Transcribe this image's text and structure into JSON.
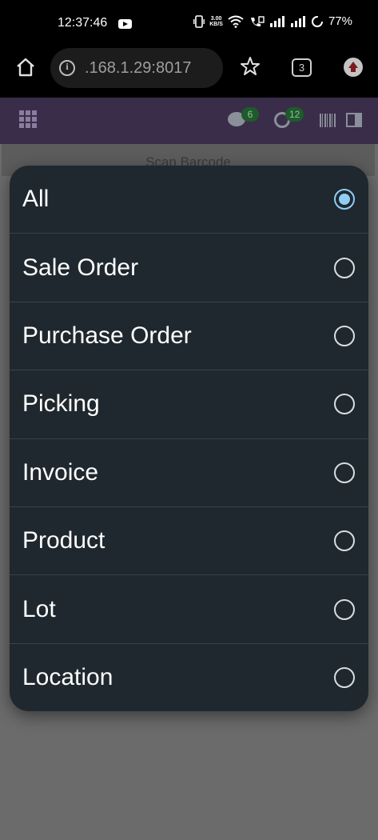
{
  "status_bar": {
    "time": "12:37:46",
    "net_speed_value": "3.00",
    "net_speed_unit": "KB/S",
    "battery": "77%"
  },
  "browser": {
    "url": ".168.1.29:8017",
    "tab_count": "3"
  },
  "app_bar": {
    "messages_badge": "6",
    "activities_badge": "12"
  },
  "page": {
    "scan_tab_label": "Scan Barcode"
  },
  "dialog": {
    "options": [
      {
        "label": "All",
        "selected": true
      },
      {
        "label": "Sale Order",
        "selected": false
      },
      {
        "label": "Purchase Order",
        "selected": false
      },
      {
        "label": "Picking",
        "selected": false
      },
      {
        "label": "Invoice",
        "selected": false
      },
      {
        "label": "Product",
        "selected": false
      },
      {
        "label": "Lot",
        "selected": false
      },
      {
        "label": "Location",
        "selected": false
      }
    ]
  },
  "colors": {
    "dialog_bg": "#1f282e",
    "accent_radio": "#90cdf4",
    "app_bar": "#3a2d4a",
    "badge_bg": "#1f5a2b"
  },
  "icons": [
    "home-icon",
    "info-icon",
    "star-icon",
    "tabs-icon",
    "update-icon",
    "apps-grid-icon",
    "chat-icon",
    "clock-icon",
    "barcode-icon",
    "split-view-icon",
    "radio-icon"
  ]
}
